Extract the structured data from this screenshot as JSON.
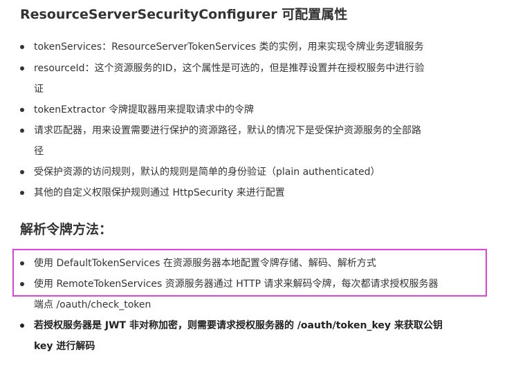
{
  "section1": {
    "title": "ResourceServerSecurityConfigurer 可配置属性",
    "items": [
      {
        "line1": "tokenServices：ResourceServerTokenServices 类的实例，用来实现令牌业务逻辑服务"
      },
      {
        "line1": "resourceId：这个资源服务的ID，这个属性是可选的，但是推荐设置并在授权服务中进行验",
        "line2": "证"
      },
      {
        "line1": "tokenExtractor 令牌提取器用来提取请求中的令牌"
      },
      {
        "line1": "请求匹配器，用来设置需要进行保护的资源路径，默认的情况下是受保护资源服务的全部路",
        "line2": "径"
      },
      {
        "line1": "受保护资源的访问规则，默认的规则是简单的身份验证（plain authenticated）"
      },
      {
        "line1": "其他的自定义权限保护规则通过 HttpSecurity 来进行配置"
      }
    ]
  },
  "section2": {
    "title": "解析令牌方法：",
    "items": [
      {
        "line1": "使用 DefaultTokenServices 在资源服务器本地配置令牌存储、解码、解析方式"
      },
      {
        "line1": "使用 RemoteTokenServices 资源服务器通过 HTTP 请求来解码令牌，每次都请求授权服务器",
        "line2": "端点 /oauth/check_token"
      },
      {
        "line1": "若授权服务器是 JWT 非对称加密，则需要请求授权服务器的 /oauth/token_key 来获取公钥",
        "line2": "key 进行解码"
      }
    ]
  },
  "colors": {
    "text": "#333333",
    "highlight_border": "#e040e0",
    "background": "#ffffff"
  }
}
